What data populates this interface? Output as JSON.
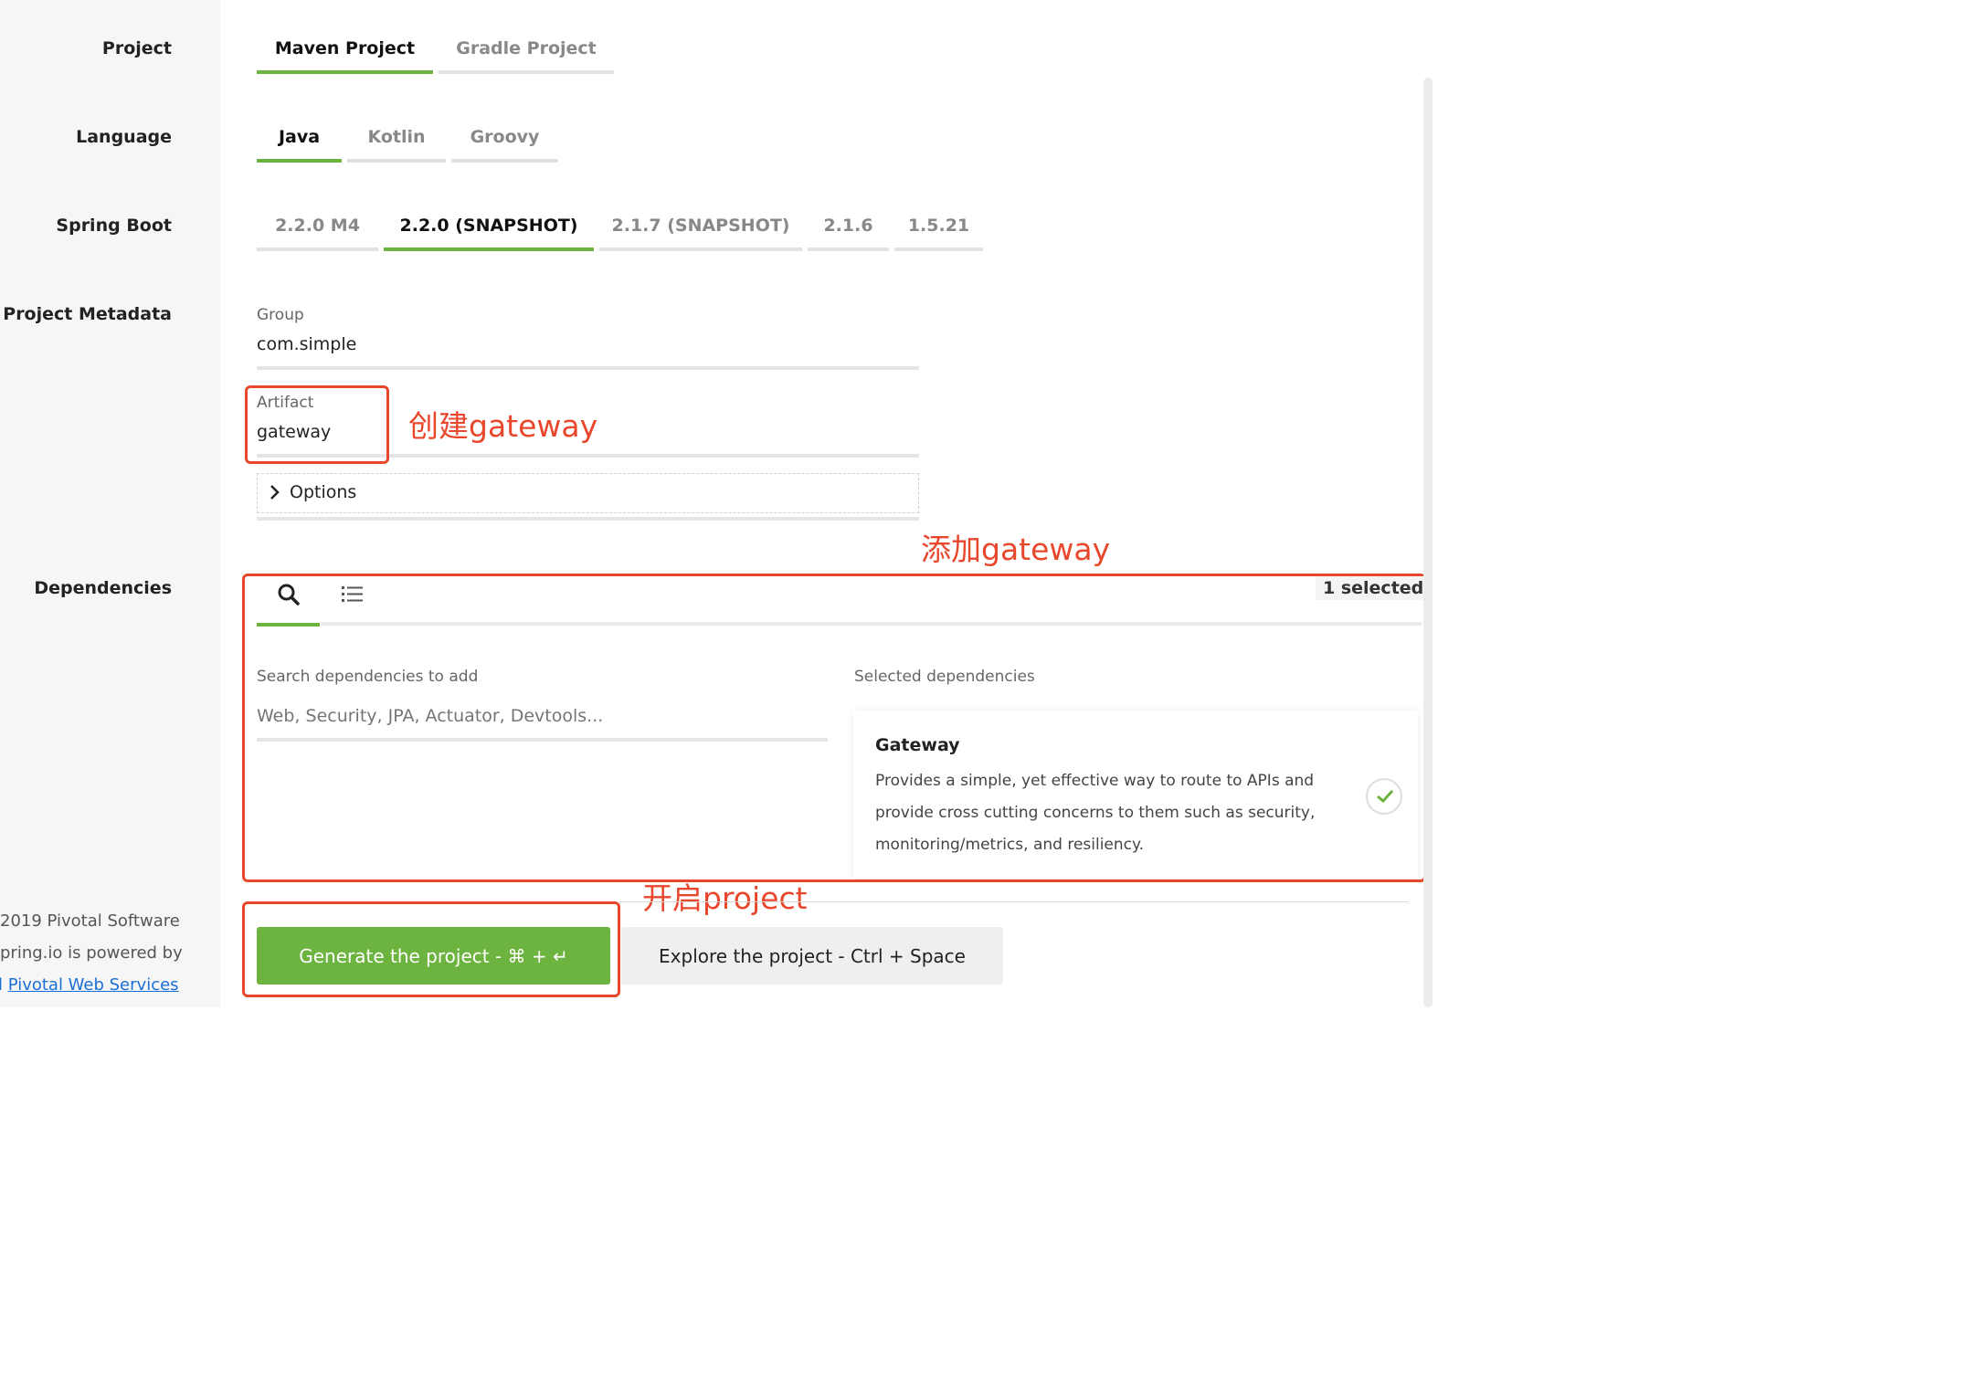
{
  "rows": {
    "project": "Project",
    "language": "Language",
    "spring_boot": "Spring Boot",
    "metadata": "Project Metadata",
    "dependencies": "Dependencies"
  },
  "project_tabs": [
    {
      "label": "Maven Project",
      "active": true
    },
    {
      "label": "Gradle Project",
      "active": false
    }
  ],
  "language_tabs": [
    {
      "label": "Java",
      "active": true
    },
    {
      "label": "Kotlin",
      "active": false
    },
    {
      "label": "Groovy",
      "active": false
    }
  ],
  "boot_tabs": [
    {
      "label": "2.2.0 M4",
      "active": false
    },
    {
      "label": "2.2.0 (SNAPSHOT)",
      "active": true
    },
    {
      "label": "2.1.7 (SNAPSHOT)",
      "active": false
    },
    {
      "label": "2.1.6",
      "active": false
    },
    {
      "label": "1.5.21",
      "active": false
    }
  ],
  "metadata": {
    "group_label": "Group",
    "group_value": "com.simple",
    "artifact_label": "Artifact",
    "artifact_value": "gateway",
    "options_label": "Options"
  },
  "annotations": {
    "create": "创建gateway",
    "add": "添加gateway",
    "open": "开启project"
  },
  "dependencies": {
    "selected_count": "1 selected",
    "search_label": "Search dependencies to add",
    "search_placeholder": "Web, Security, JPA, Actuator, Devtools...",
    "selected_label": "Selected dependencies",
    "items": [
      {
        "name": "Gateway",
        "description": "Provides a simple, yet effective way to route to APIs and provide cross cutting concerns to them such as security, monitoring/metrics, and resiliency."
      }
    ]
  },
  "actions": {
    "generate": "Generate the project - ⌘ + ↵",
    "explore": "Explore the project - Ctrl + Space"
  },
  "footer": {
    "copyright": "2019 Pivotal Software",
    "powered": "pring.io is powered by",
    "link": "Pivotal Web Services"
  },
  "colors": {
    "accent": "#6db33f",
    "annotation": "#e8472c"
  }
}
